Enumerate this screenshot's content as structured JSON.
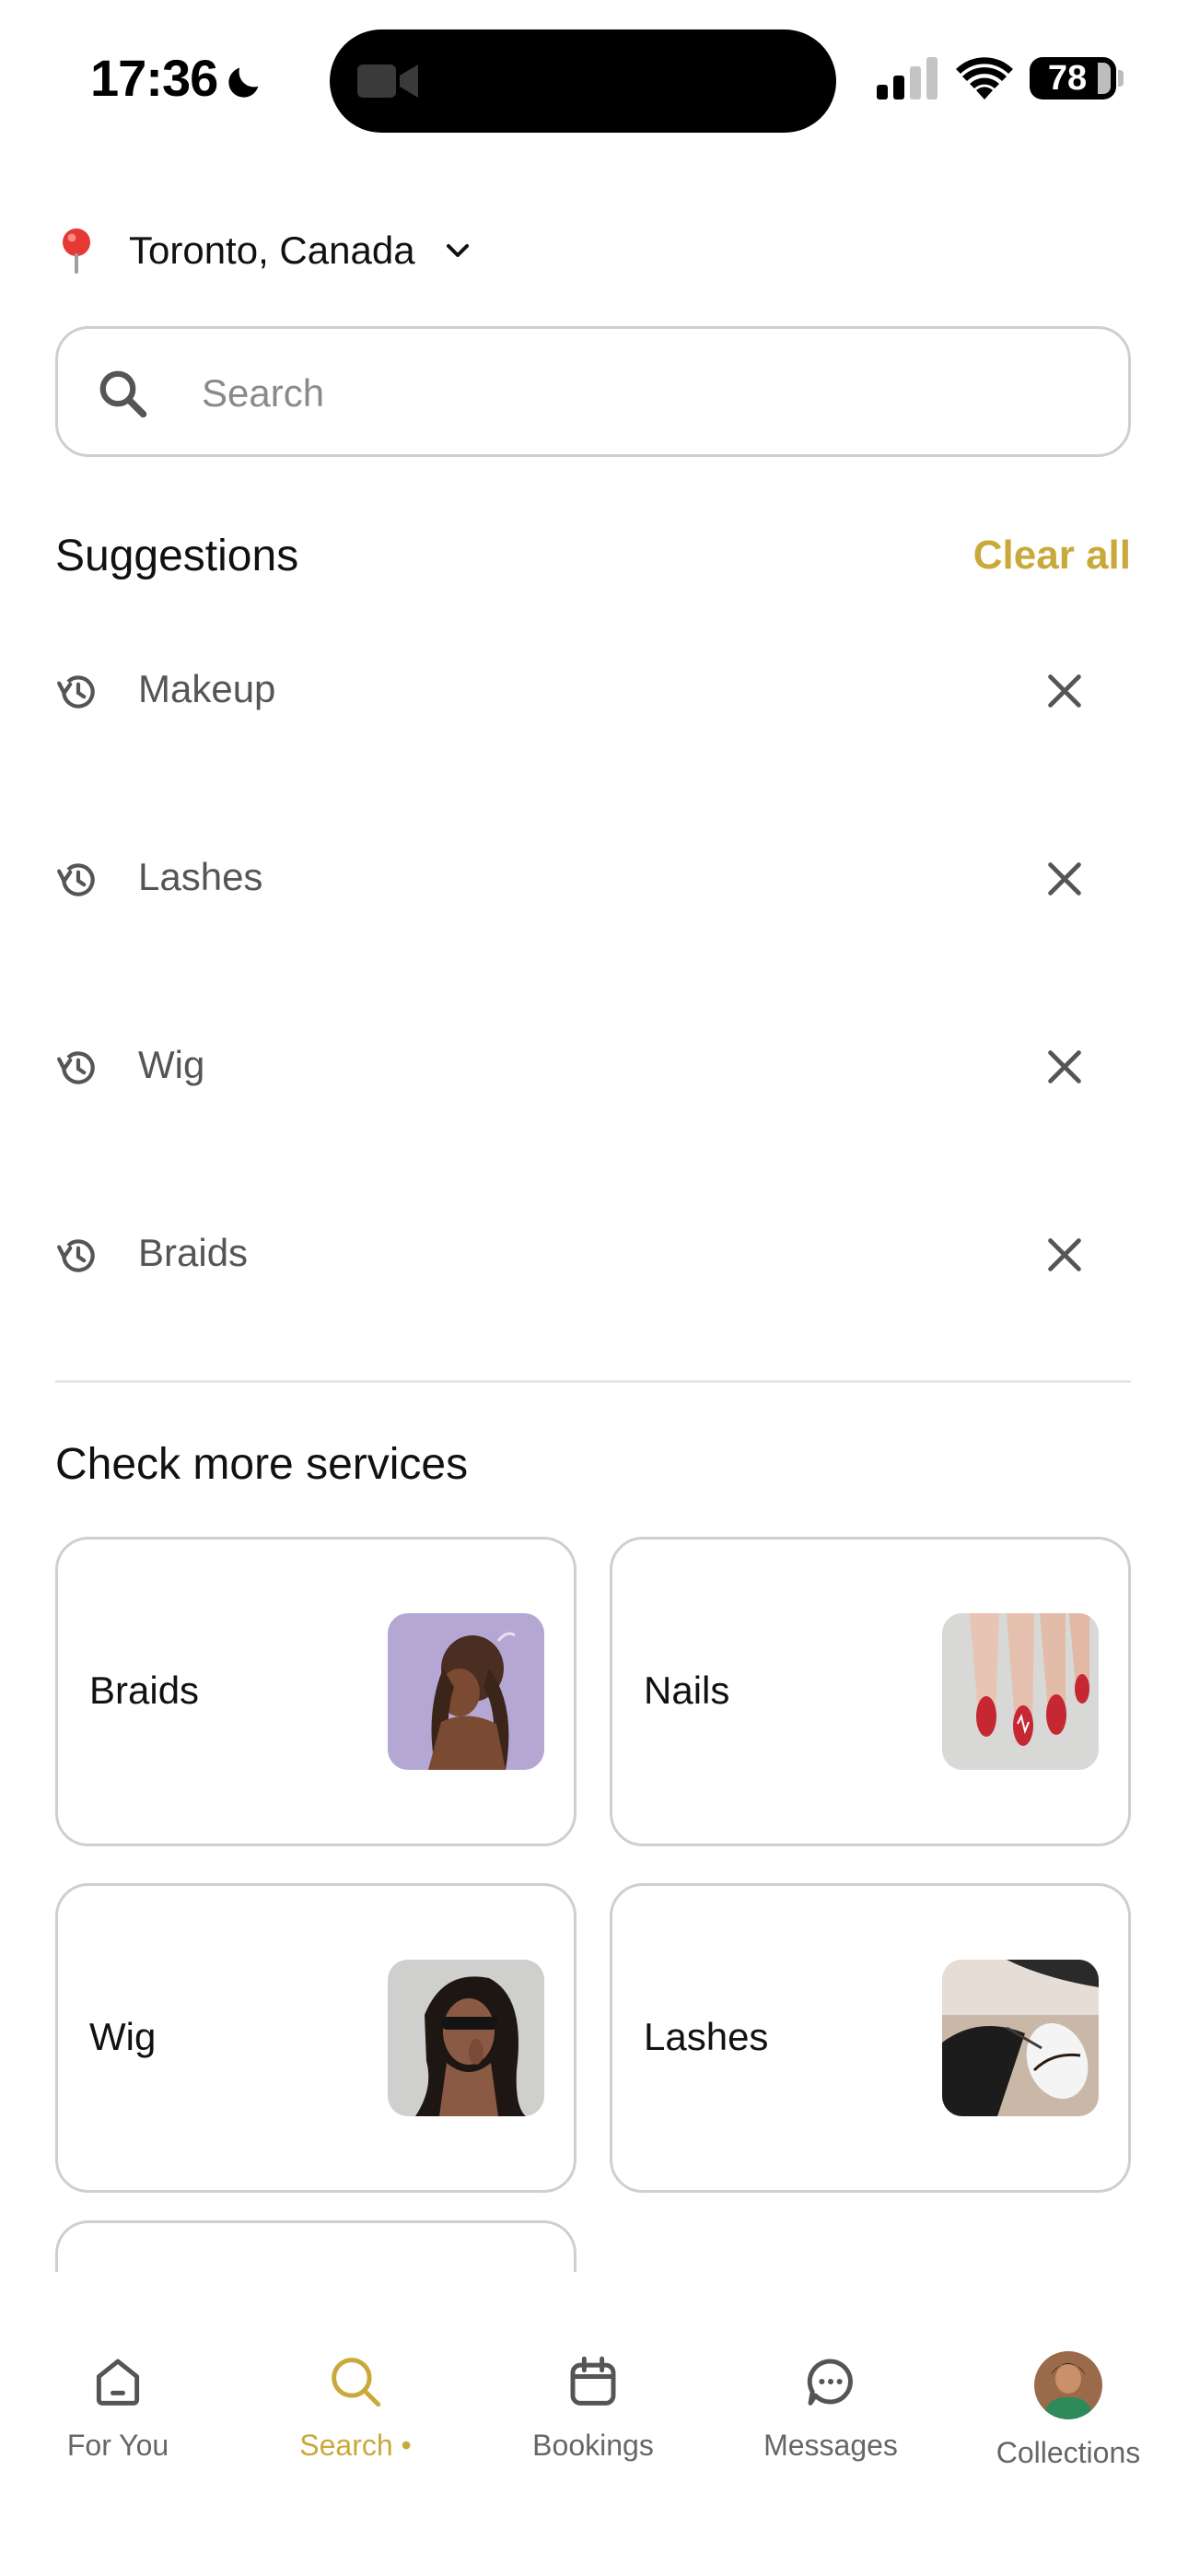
{
  "status_bar": {
    "time": "17:36",
    "battery": "78"
  },
  "location": {
    "label": "Toronto, Canada"
  },
  "search": {
    "placeholder": "Search",
    "value": ""
  },
  "suggestions": {
    "title": "Suggestions",
    "clear_all": "Clear all",
    "items": [
      {
        "label": "Makeup"
      },
      {
        "label": "Lashes"
      },
      {
        "label": "Wig"
      },
      {
        "label": "Braids"
      }
    ]
  },
  "services": {
    "title": "Check more services",
    "items": [
      {
        "label": "Braids"
      },
      {
        "label": "Nails"
      },
      {
        "label": "Wig"
      },
      {
        "label": "Lashes"
      }
    ]
  },
  "nav": {
    "items": [
      {
        "label": "For You",
        "active": false
      },
      {
        "label": "Search",
        "active": true
      },
      {
        "label": "Bookings",
        "active": false
      },
      {
        "label": "Messages",
        "active": false
      },
      {
        "label": "Collections",
        "active": false
      }
    ]
  },
  "colors": {
    "accent": "#C9A93A",
    "border": "#CFCFCF",
    "text_primary": "#111111",
    "text_secondary": "#555555"
  },
  "icons": {
    "location": "map-pin-icon",
    "search": "search-icon",
    "history": "history-icon",
    "remove": "close-icon",
    "nav": [
      "home-icon",
      "search-icon",
      "calendar-icon",
      "chat-bubble-icon",
      "avatar"
    ]
  }
}
